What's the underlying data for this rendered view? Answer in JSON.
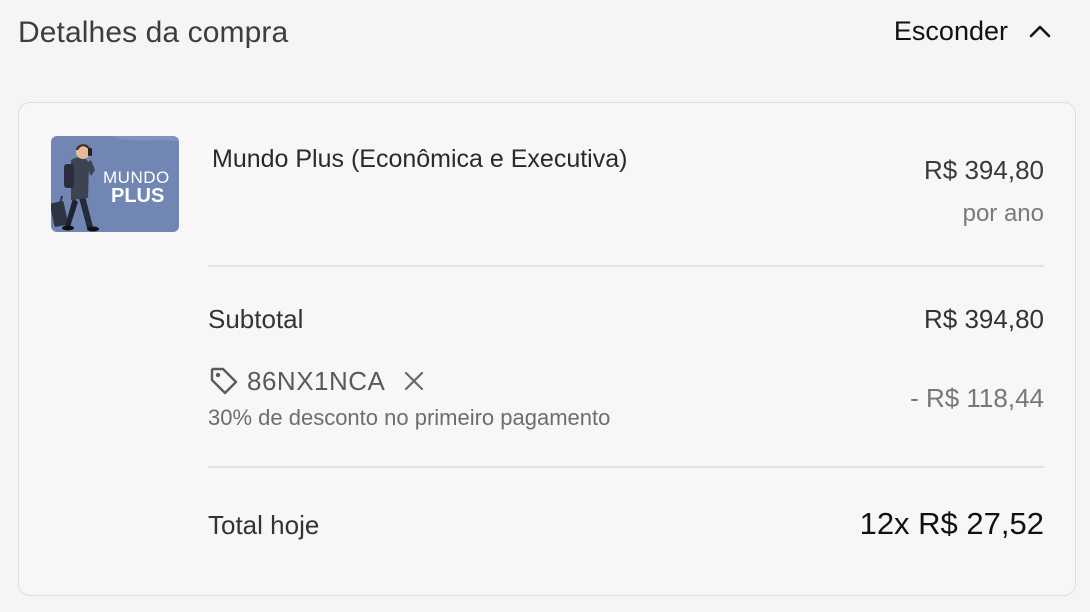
{
  "header": {
    "title": "Detalhes da compra",
    "toggle_label": "Esconder",
    "toggle_icon": "chevron-up-icon"
  },
  "product": {
    "image_text_line1": "MUNDO",
    "image_text_line2": "PLUS",
    "name": "Mundo Plus (Econômica e Executiva)",
    "price": "R$ 394,80",
    "period": "por ano"
  },
  "summary": {
    "subtotal_label": "Subtotal",
    "subtotal_value": "R$ 394,80",
    "coupon_icon": "tag-icon",
    "coupon_code": "86NX1NCA",
    "coupon_remove_icon": "close-icon",
    "coupon_description": "30% de desconto no primeiro pagamento",
    "discount_value": "- R$ 118,44",
    "total_label": "Total hoje",
    "total_value": "12x R$ 27,52"
  },
  "colors": {
    "background": "#f5f5f5",
    "thumbnail_bg": "#7186b2",
    "divider": "#e2e2e2"
  }
}
